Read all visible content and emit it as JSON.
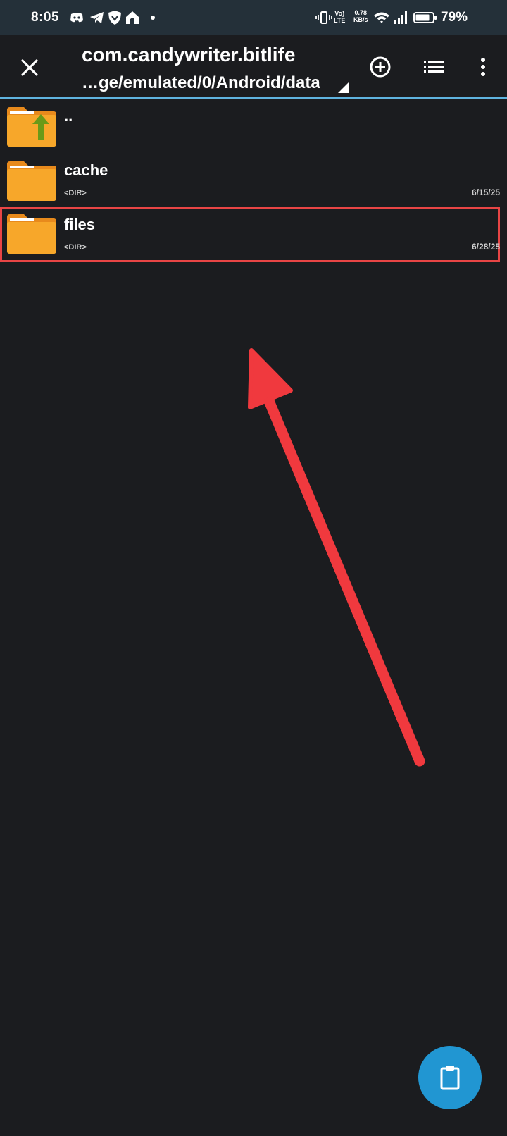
{
  "status_bar": {
    "time": "8:05",
    "net_speed_value": "0.78",
    "net_speed_unit": "KB/s",
    "battery_percent": "79%",
    "icons": [
      "discord-icon",
      "telegram-icon",
      "shield-icon",
      "home-icon",
      "dot-icon",
      "vibrate-icon",
      "volte-icon",
      "wifi-icon",
      "signal-icon",
      "battery-icon"
    ],
    "volte_label_1": "Vo)",
    "volte_label_2": "LTE"
  },
  "toolbar": {
    "title": "com.candywriter.bitlife",
    "path": "…ge/emulated/0/Android/data",
    "buttons": [
      "close-icon",
      "add-circle-icon",
      "list-view-icon",
      "more-vert-icon"
    ]
  },
  "file_list": [
    {
      "name": "..",
      "type": "",
      "date": "",
      "icon": "folder-up-icon"
    },
    {
      "name": "cache",
      "type": "<DIR>",
      "date": "6/15/25",
      "icon": "folder-icon"
    },
    {
      "name": "files",
      "type": "<DIR>",
      "date": "6/28/25",
      "icon": "folder-icon",
      "highlighted": true
    }
  ],
  "fab": {
    "icon": "clipboard-icon"
  },
  "colors": {
    "background": "#1b1c1f",
    "status_bar": "#243039",
    "accent_line": "#5fb3df",
    "folder": "#f7a72a",
    "highlight": "#e84545",
    "fab": "#2196d2"
  }
}
